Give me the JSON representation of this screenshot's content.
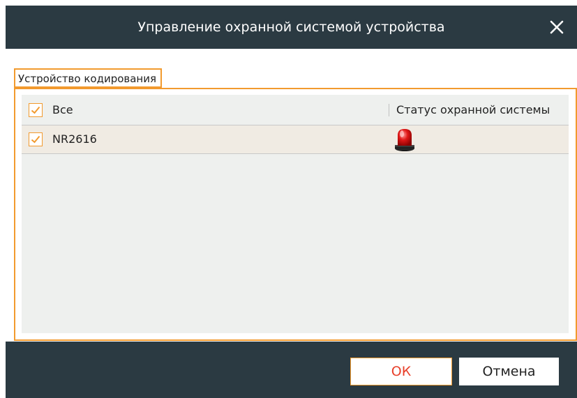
{
  "dialog": {
    "title": "Управление охранной системой устройства",
    "close_icon": "close-icon"
  },
  "group": {
    "legend": "Устройство кодирования"
  },
  "table": {
    "header": {
      "select_all_label": "Все",
      "select_all_checked": true,
      "status_column": "Статус охранной системы"
    },
    "rows": [
      {
        "name": "NR2616",
        "checked": true,
        "status_icon": "alarm-beacon-icon"
      }
    ]
  },
  "buttons": {
    "ok_label": "ОК",
    "cancel_label": "Отмена"
  },
  "colors": {
    "titlebar_bg": "#2b3a42",
    "accent": "#f29a2e",
    "ok_text": "#e8402a",
    "row_bg": "#f0ebe3",
    "table_bg": "#eef0ee"
  }
}
